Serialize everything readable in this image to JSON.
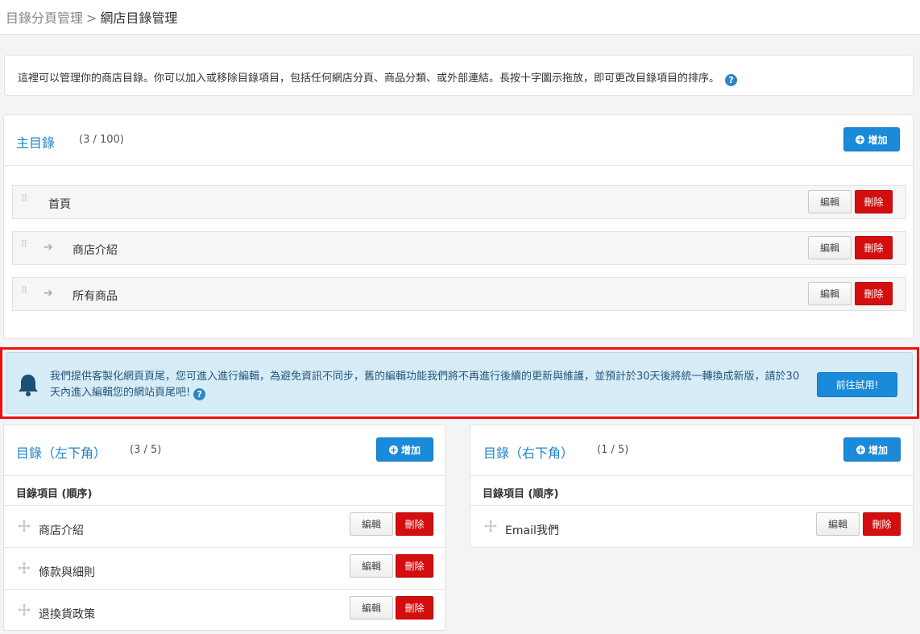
{
  "breadcrumb": {
    "parent": "目錄分頁管理",
    "separator": ">",
    "current": "網店目錄管理"
  },
  "info": {
    "text": "這裡可以管理你的商店目錄。你可以加入或移除目錄項目，包括任何網店分頁、商品分類、或外部連結。長按十字圖示拖放，即可更改目錄項目的排序。",
    "help_icon": "?"
  },
  "main_menu": {
    "title": "主目錄",
    "count": "(3 / 100)",
    "add_label": "增加",
    "items": [
      {
        "label": "首頁",
        "edit": "編輯",
        "delete": "刪除"
      },
      {
        "label": "商店介紹",
        "edit": "編輯",
        "delete": "刪除"
      },
      {
        "label": "所有商品",
        "edit": "編輯",
        "delete": "刪除"
      }
    ]
  },
  "notice": {
    "text": "我們提供客製化網頁頁尾，您可進入進行編輯，為避免資訊不同步，舊的編輯功能我們將不再進行後續的更新與維護，並預計於30天後將統一轉換成新版，請於30天內進入編輯您的網站頁尾吧!",
    "help_icon": "?",
    "button": "前往試用!"
  },
  "left_menu": {
    "title": "目錄（左下角）",
    "count": "(3 / 5)",
    "add_label": "增加",
    "column_label": "目錄項目 (順序)",
    "items": [
      {
        "label": "商店介紹",
        "edit": "編輯",
        "delete": "刪除"
      },
      {
        "label": "條款與細則",
        "edit": "編輯",
        "delete": "刪除"
      },
      {
        "label": "退換貨政策",
        "edit": "編輯",
        "delete": "刪除"
      }
    ]
  },
  "right_menu": {
    "title": "目錄（右下角）",
    "count": "(1 / 5)",
    "add_label": "增加",
    "column_label": "目錄項目 (順序)",
    "items": [
      {
        "label": "Email我們",
        "edit": "編輯",
        "delete": "刪除"
      }
    ]
  },
  "colors": {
    "accent": "#1a8ad9",
    "danger": "#d40e0e",
    "notice_bg": "#d6ecf7",
    "highlight": "#ee1010"
  }
}
